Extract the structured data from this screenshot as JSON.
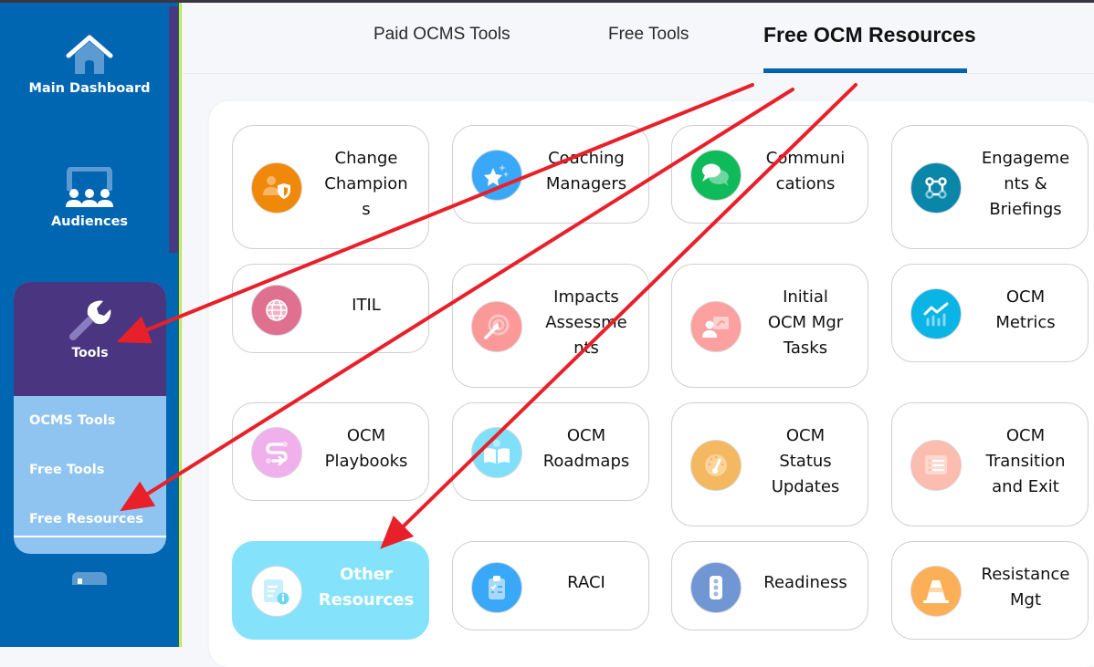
{
  "sidebar": {
    "items": [
      {
        "label": "Main Dashboard",
        "icon": "home-icon"
      },
      {
        "label": "Audiences",
        "icon": "audience-icon"
      },
      {
        "label": "Tools",
        "icon": "wrench-icon"
      }
    ],
    "tools_submenu": [
      {
        "label": "OCMS Tools"
      },
      {
        "label": "Free Tools"
      },
      {
        "label": "Free Resources",
        "active": true
      }
    ]
  },
  "tabs": [
    {
      "label": "Paid OCMS Tools"
    },
    {
      "label": "Free Tools"
    },
    {
      "label": "Free OCM Resources",
      "active": true
    }
  ],
  "colors": {
    "sidebar_bg": "#0066b2",
    "tools_header": "#4a3680",
    "submenu_bg": "#8fc3f0",
    "tab_underline": "#0063ae",
    "selected_card": "#84e3fb",
    "annotation_arrow": "#e8202a"
  },
  "cards": [
    {
      "label": "Change Champions",
      "lines": [
        "Change",
        "Champion",
        "s"
      ],
      "icon": "user-shield-icon",
      "color": "#f0880a"
    },
    {
      "label": "Coaching Managers",
      "lines": [
        "Coaching",
        "Managers"
      ],
      "icon": "star-sparkle-icon",
      "color": "#3aa8f8"
    },
    {
      "label": "Communications",
      "lines": [
        "Communi",
        "cations"
      ],
      "icon": "chat-bubbles-icon",
      "color": "#0fba5a"
    },
    {
      "label": "Engagements & Briefings",
      "lines": [
        "Engageme",
        "nts &",
        "Briefings"
      ],
      "icon": "command-icon",
      "color": "#0a86a8"
    },
    {
      "label": "ITIL",
      "lines": [
        "ITIL"
      ],
      "icon": "globe-icon",
      "color": "#e07090"
    },
    {
      "label": "Impacts Assessments",
      "lines": [
        "Impacts",
        "Assessme",
        "nts"
      ],
      "icon": "target-arrow-icon",
      "color": "#fb9898"
    },
    {
      "label": "Initial OCM Mgr Tasks",
      "lines": [
        "Initial",
        "OCM Mgr",
        "Tasks"
      ],
      "icon": "presenter-icon",
      "color": "#fca0a0"
    },
    {
      "label": "OCM Metrics",
      "lines": [
        "OCM",
        "Metrics"
      ],
      "icon": "chart-trend-icon",
      "color": "#0ab4e4"
    },
    {
      "label": "OCM Playbooks",
      "lines": [
        "OCM",
        "Playbooks"
      ],
      "icon": "route-icon",
      "color": "#f0b0ec"
    },
    {
      "label": "OCM Roadmaps",
      "lines": [
        "OCM",
        "Roadmaps"
      ],
      "icon": "open-book-icon",
      "color": "#80e0fa"
    },
    {
      "label": "OCM Status Updates",
      "lines": [
        "OCM",
        "Status",
        "Updates"
      ],
      "icon": "gauge-icon",
      "color": "#f4b860"
    },
    {
      "label": "OCM Transition and Exit",
      "lines": [
        "OCM",
        "Transition",
        "and Exit"
      ],
      "icon": "list-icon",
      "color": "#fcbcae"
    },
    {
      "label": "Other Resources",
      "lines": [
        "Other",
        "Resources"
      ],
      "icon": "document-info-icon",
      "color": "#ffffff",
      "selected": true
    },
    {
      "label": "RACI",
      "lines": [
        "RACI"
      ],
      "icon": "clipboard-check-icon",
      "color": "#3aa8f8"
    },
    {
      "label": "Readiness",
      "lines": [
        "Readiness"
      ],
      "icon": "traffic-light-icon",
      "color": "#7096d4"
    },
    {
      "label": "Resistance Mgt",
      "lines": [
        "Resistance",
        "Mgt"
      ],
      "icon": "traffic-cone-icon",
      "color": "#fbb058"
    }
  ]
}
